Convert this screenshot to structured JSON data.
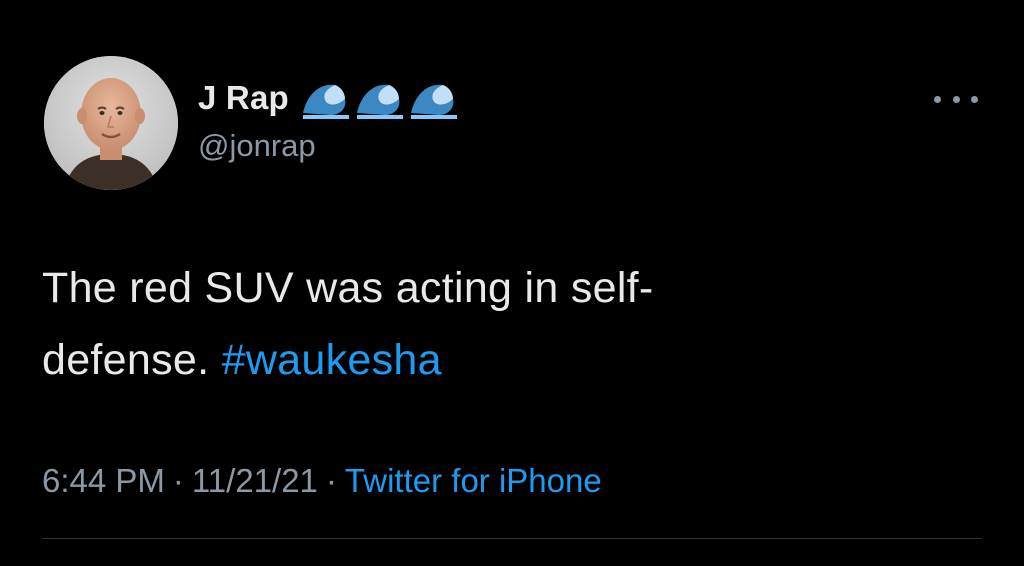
{
  "author": {
    "display_name": "J Rap",
    "handle": "@jonrap",
    "name_emoji": [
      "water-wave-icon",
      "water-wave-icon",
      "water-wave-icon"
    ]
  },
  "tweet": {
    "text": "The red SUV was acting in self-defense.",
    "text_line1": "The red SUV was acting in self-",
    "text_line2": "defense.",
    "hashtag": "#waukesha"
  },
  "meta": {
    "time": "6:44 PM",
    "separator": "·",
    "date": "11/21/21",
    "source": "Twitter for iPhone"
  },
  "colors": {
    "background": "#000000",
    "text": "#e7e9ea",
    "secondary_text": "#8b98a5",
    "link": "#1d9bf0"
  }
}
